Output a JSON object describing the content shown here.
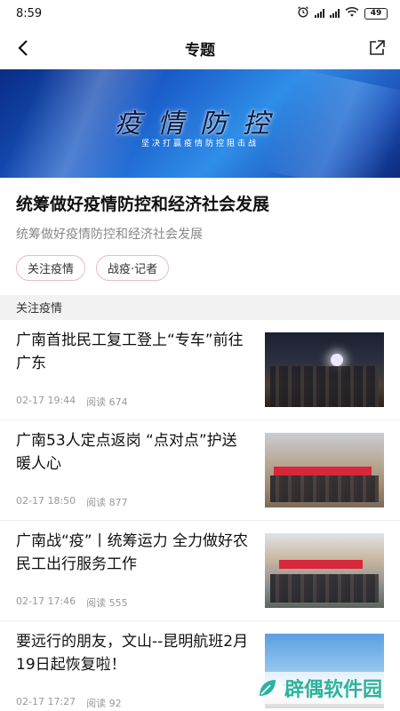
{
  "status": {
    "time": "8:59",
    "battery": "49"
  },
  "nav": {
    "title": "专题"
  },
  "banner": {
    "title": "疫情防控",
    "subtitle": "坚决打赢疫情防控阻击战"
  },
  "topic": {
    "title": "统筹做好疫情防控和经济社会发展",
    "description": "统筹做好疫情防控和经济社会发展",
    "tags": [
      "关注疫情",
      "战疫·记者"
    ]
  },
  "section": {
    "label": "关注疫情"
  },
  "news": [
    {
      "title": "广南首批民工复工登上“专车”前往广东",
      "time": "02-17 19:44",
      "reads": "阅读 674"
    },
    {
      "title": "广南53人定点返岗 “点对点”护送暖人心",
      "time": "02-17 18:50",
      "reads": "阅读 877"
    },
    {
      "title": "广南战“疫”丨统筹运力 全力做好农民工出行服务工作",
      "time": "02-17 17:46",
      "reads": "阅读 555"
    },
    {
      "title": "要远行的朋友，文山--昆明航班2月19日起恢复啦！",
      "time": "02-17 17:27",
      "reads": "阅读 92"
    }
  ],
  "watermark": {
    "text": "辟偶软件园"
  }
}
